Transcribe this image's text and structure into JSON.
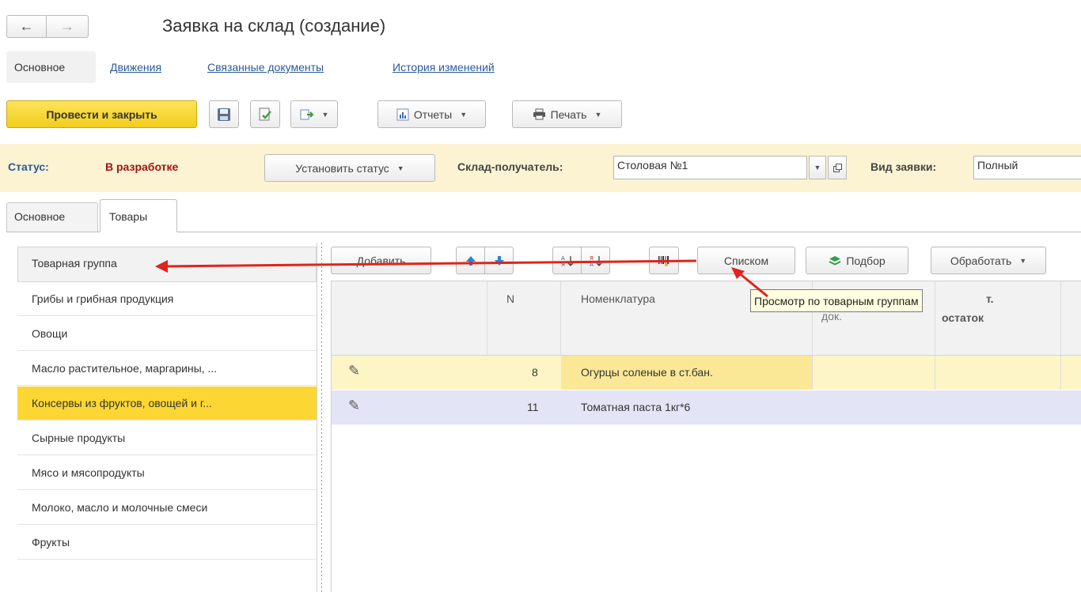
{
  "window": {
    "title": "Заявка на склад (создание)"
  },
  "nav": {
    "main_tab": "Основное",
    "links": [
      "Движения",
      "Связанные документы",
      "История изменений"
    ]
  },
  "toolbar": {
    "post_close": "Провести и закрыть",
    "reports": "Отчеты",
    "print": "Печать"
  },
  "status_bar": {
    "status_label": "Статус:",
    "status_value": "В разработке",
    "set_status": "Установить статус",
    "warehouse_label": "Склад-получатель:",
    "warehouse_value": "Столовая №1",
    "type_label": "Вид заявки:",
    "type_value": "Полный"
  },
  "tabs": [
    "Основное",
    "Товары"
  ],
  "sidebar": {
    "header": "Товарная группа",
    "items": [
      "Грибы и грибная продукция",
      "Овощи",
      "Масло растительное, маргарины, ...",
      "Консервы из фруктов, овощей и г...",
      "Сырные продукты",
      "Мясо и мясопродукты",
      "Молоко, масло и молочные смеси",
      "Фрукты"
    ],
    "selected_index": 3
  },
  "table_toolbar": {
    "add": "Добавить",
    "list": "Списком",
    "selection": "Подбор",
    "process": "Обработать"
  },
  "tooltip": "Просмотр по товарным группам",
  "table": {
    "columns": {
      "n": "N",
      "nomenclature": "Номенклатура",
      "doc": "док.",
      "remainder_a": "т.",
      "remainder_b": "остаток"
    },
    "rows": [
      {
        "n": "8",
        "name": "Огурцы соленые в ст.бан."
      },
      {
        "n": "11",
        "name": "Томатная паста 1кг*6"
      }
    ]
  },
  "colors": {
    "accent_yellow": "#f5d63b",
    "status_bg": "#fbf3d2",
    "selected_row": "#fcd734",
    "row_highlight": "#fdf5c6",
    "row_alt": "#e4e4f7",
    "annotation_red": "#e0241c"
  }
}
